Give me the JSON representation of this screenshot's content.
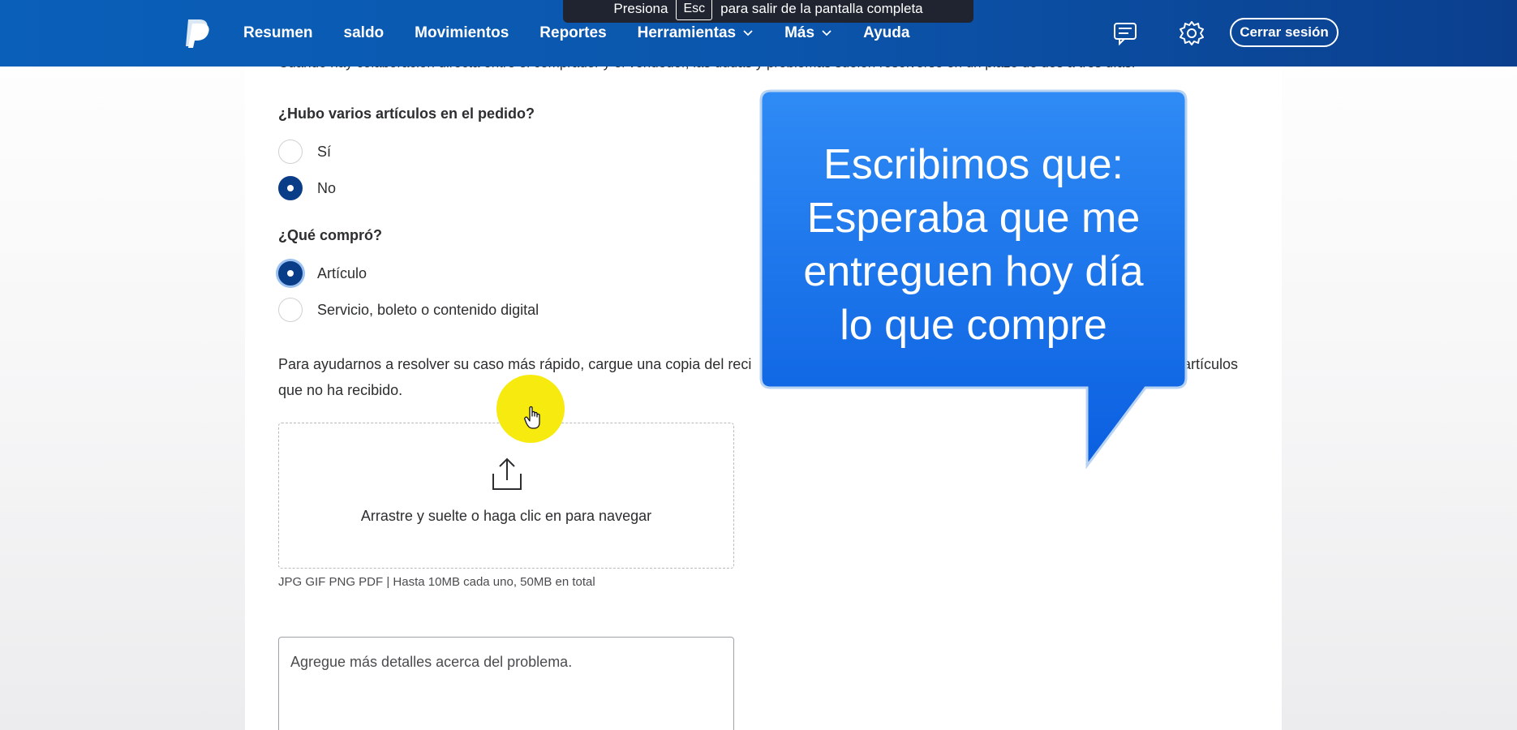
{
  "header": {
    "nav": [
      {
        "label": "Resumen"
      },
      {
        "label": "saldo"
      },
      {
        "label": "Movimientos"
      },
      {
        "label": "Reportes"
      },
      {
        "label": "Herramientas",
        "has_dropdown": true
      },
      {
        "label": "Más",
        "has_dropdown": true
      },
      {
        "label": "Ayuda"
      }
    ],
    "icons": [
      "paypal-logo-icon",
      "messages-icon",
      "gear-icon",
      "chevron-down-icon"
    ],
    "logout_label": "Cerrar sesión"
  },
  "fullscreen_notice": {
    "before": "Presiona",
    "key": "Esc",
    "after": "para salir de la pantalla completa"
  },
  "form": {
    "cut_text": "Cuando hay colaboración directa entre el comprador y el vendedor, las dudas y problemas suelen resolverse en un plazo de dos a tres días.",
    "q1": {
      "question": "¿Hubo varios artículos en el pedido?",
      "options": [
        {
          "label": "Sí",
          "checked": false
        },
        {
          "label": "No",
          "checked": true
        }
      ]
    },
    "q2": {
      "question": "¿Qué compró?",
      "options": [
        {
          "label": "Artículo",
          "checked": true
        },
        {
          "label": "Servicio, boleto o contenido digital",
          "checked": false
        }
      ]
    },
    "help_line1": "Para ayudarnos a resolver su caso más rápido, cargue una copia del reci",
    "help_line1_tail": "artículos",
    "help_line2": "que no ha recibido.",
    "dropzone_text": "Arrastre y suelte o haga clic en para navegar",
    "file_hint": "JPG GIF PNG PDF | Hasta 10MB cada uno, 50MB en total",
    "details_placeholder": "Agregue más detalles acerca del problema."
  },
  "bubble": {
    "lines": [
      "Escribimos que:",
      "Esperaba que me",
      "entreguen hoy día",
      "lo que compre"
    ],
    "color_top": "#2f8bf5",
    "color_bottom": "#0a5fe0"
  },
  "colors": {
    "header": "#0b56ad",
    "radio_checked": "#0a3d87",
    "highlight": "#f7ea0f"
  }
}
